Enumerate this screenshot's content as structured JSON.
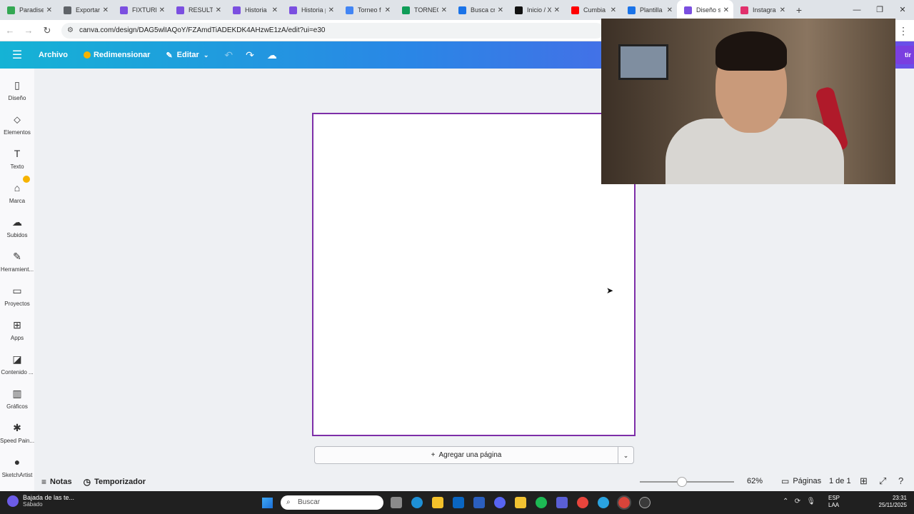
{
  "browser": {
    "tabs": [
      {
        "label": "Paradise",
        "color": "#34a853"
      },
      {
        "label": "Exportar",
        "color": "#5f6368"
      },
      {
        "label": "FIXTURE",
        "color": "#7b4fe0"
      },
      {
        "label": "RESULTA",
        "color": "#7b4fe0"
      },
      {
        "label": "Historia",
        "color": "#7b4fe0"
      },
      {
        "label": "Historia p",
        "color": "#7b4fe0"
      },
      {
        "label": "Torneo f",
        "color": "#4285f4"
      },
      {
        "label": "TORNEO",
        "color": "#0f9d58"
      },
      {
        "label": "Busca cr",
        "color": "#1a73e8"
      },
      {
        "label": "Inicio / X",
        "color": "#111111"
      },
      {
        "label": "Cumbia",
        "color": "#ff0000"
      },
      {
        "label": "Plantilla",
        "color": "#1a73e8"
      },
      {
        "label": "Diseño s",
        "color": "#7b4fe0",
        "active": true
      },
      {
        "label": "Instagra",
        "color": "#e1306c"
      }
    ],
    "new_tab": "+",
    "url": "canva.com/design/DAG5wlIAQoY/FZAmdTiADEKDK4AHzwE1zA/edit?ui=e30"
  },
  "canva_header": {
    "menu_icon": "hamburger-icon",
    "archivo": "Archivo",
    "redimensionar": "Redimensionar",
    "editar": "Editar",
    "share_partial": "tir"
  },
  "sidebar": {
    "items": [
      {
        "label": "Diseño",
        "icon": "design-icon",
        "glyph": "▯"
      },
      {
        "label": "Elementos",
        "icon": "elements-icon",
        "glyph": "⬦"
      },
      {
        "label": "Texto",
        "icon": "text-icon",
        "glyph": "T"
      },
      {
        "label": "Marca",
        "icon": "brand-icon",
        "glyph": "⌂"
      },
      {
        "label": "Subidos",
        "icon": "upload-cloud-icon",
        "glyph": "☁"
      },
      {
        "label": "Herramient...",
        "icon": "tools-icon",
        "glyph": "✎"
      },
      {
        "label": "Proyectos",
        "icon": "folder-icon",
        "glyph": "▭"
      },
      {
        "label": "Apps",
        "icon": "apps-icon",
        "glyph": "⊞"
      },
      {
        "label": "Contenido ...",
        "icon": "content-icon",
        "glyph": "◪"
      },
      {
        "label": "Gráficos",
        "icon": "charts-icon",
        "glyph": "▥"
      },
      {
        "label": "Speed Pain...",
        "icon": "speed-paint-icon",
        "glyph": "✱"
      },
      {
        "label": "SketchArtist",
        "icon": "sketch-artist-icon",
        "glyph": "●"
      }
    ]
  },
  "canvas": {
    "add_page": "Agregar una página"
  },
  "bottom": {
    "notas": "Notas",
    "temporizador": "Temporizador",
    "zoom": "62%",
    "zoom_fraction": 0.45,
    "paginas": "Páginas",
    "page_count": "1 de 1"
  },
  "taskbar": {
    "news_title": "Bajada de las te...",
    "news_sub": "Sábado",
    "search_placeholder": "Buscar",
    "lang1": "ESP",
    "lang2": "LAA",
    "time": "23:31",
    "date": "25/11/2025"
  }
}
